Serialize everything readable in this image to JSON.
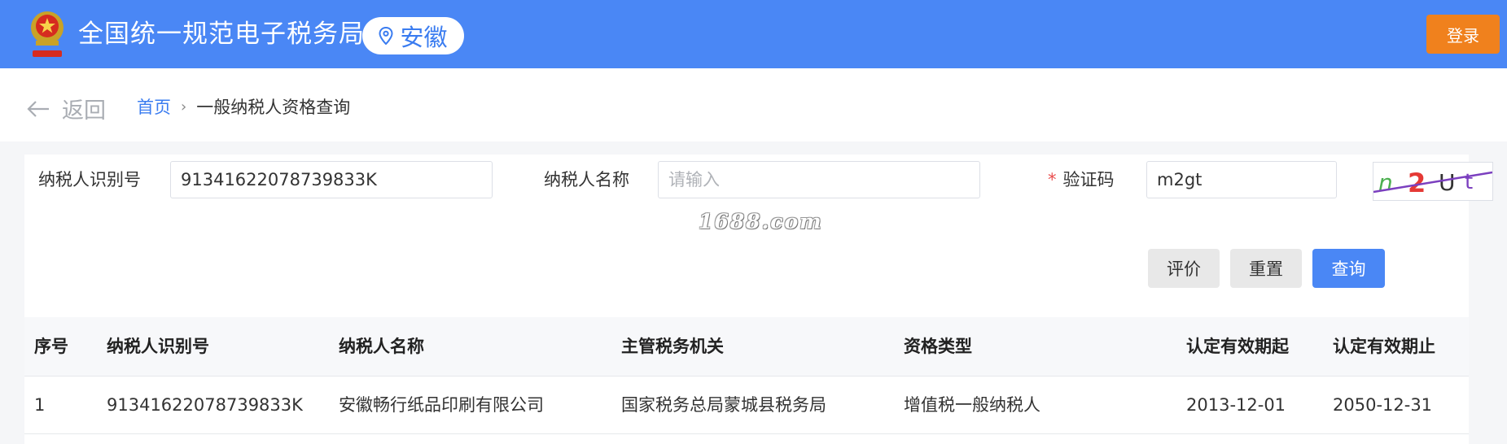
{
  "header": {
    "site_title": "全国统一规范电子税务局",
    "region": "安徽",
    "login_label": "登录",
    "icons": [
      "tax-emblem-logo",
      "location-pin-icon"
    ],
    "brand_color": "#4a87f5",
    "login_color": "#f0811d"
  },
  "nav": {
    "back_label": "返回",
    "breadcrumb_home": "首页",
    "breadcrumb_separator": "›",
    "breadcrumb_current": "一般纳税人资格查询"
  },
  "form": {
    "taxpayer_id_label": "纳税人识别号",
    "taxpayer_id_value": "91341622078739833K",
    "taxpayer_name_label": "纳税人名称",
    "taxpayer_name_placeholder": "请输入",
    "captcha_required_mark": "*",
    "captcha_label": "验证码",
    "captcha_value": "m2gt",
    "captcha_image_text": "n2Ut"
  },
  "watermark": "1688.com",
  "buttons": {
    "evaluate": "评价",
    "reset": "重置",
    "query": "查询"
  },
  "table": {
    "columns": [
      "序号",
      "纳税人识别号",
      "纳税人名称",
      "主管税务机关",
      "资格类型",
      "认定有效期起",
      "认定有效期止"
    ],
    "rows": [
      [
        "1",
        "91341622078739833K",
        "安徽畅行纸品印刷有限公司",
        "国家税务总局蒙城县税务局",
        "增值税一般纳税人",
        "2013-12-01",
        "2050-12-31"
      ]
    ]
  }
}
